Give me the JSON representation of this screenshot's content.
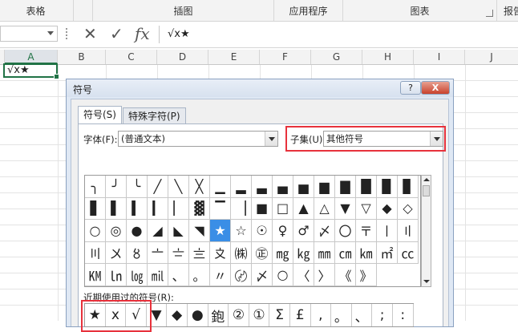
{
  "ribbon": {
    "groups": [
      "表格",
      "插图",
      "应用程序",
      "图表",
      "报告"
    ]
  },
  "formula_bar": {
    "cancel_icon": "✕",
    "enter_icon": "✓",
    "fx_label": "fx",
    "content": "√x★"
  },
  "columns": [
    "A",
    "B",
    "C",
    "D",
    "E",
    "F",
    "G",
    "H",
    "I",
    "J"
  ],
  "cell_a1": "√x★",
  "dialog": {
    "title": "符号",
    "help": "?",
    "close": "X",
    "tabs": [
      "符号(S)",
      "特殊字符(P)"
    ],
    "font_label": "字体(F):",
    "font_value": "(普通文本)",
    "subset_label": "子集(U):",
    "subset_value": "其他符号",
    "recent_label": "近期使用过的符号(R):",
    "symbols": [
      "╮",
      "╯",
      "╰",
      "╱",
      "╲",
      "╳",
      "▁",
      "▂",
      "▃",
      "▄",
      "▅",
      "▆",
      "▇",
      "█",
      "▉",
      "▊",
      "▋",
      "▌",
      "▍",
      "▎",
      "▏",
      "▓",
      "▔",
      "▕",
      "■",
      "□",
      "▲",
      "△",
      "▼",
      "▽",
      "◆",
      "◇",
      "○",
      "◎",
      "●",
      "◢",
      "◣",
      "◥",
      "★",
      "☆",
      "☉",
      "♀",
      "♂",
      "〆",
      "〇",
      "〒",
      "〡",
      "〢",
      "〣",
      "〤",
      "〥",
      "〦",
      "〧",
      "〨",
      "〩",
      "㈱",
      "㊣",
      "㎎",
      "㎏",
      "㎜",
      "㎝",
      "㎞",
      "㎡",
      "㏄",
      "㏎",
      "㏑",
      "㏒",
      "㏕",
      "、",
      "。",
      "〃",
      "〄",
      "〆",
      "○",
      "〈",
      "〉",
      "《",
      "》"
    ],
    "selected_symbol_index": 38,
    "recent_symbols": [
      "★",
      "x",
      "√",
      "▼",
      "◆",
      "●",
      "鉋",
      "②",
      "①",
      "Σ",
      "£",
      ",",
      "。",
      "、",
      ";",
      ":"
    ]
  }
}
